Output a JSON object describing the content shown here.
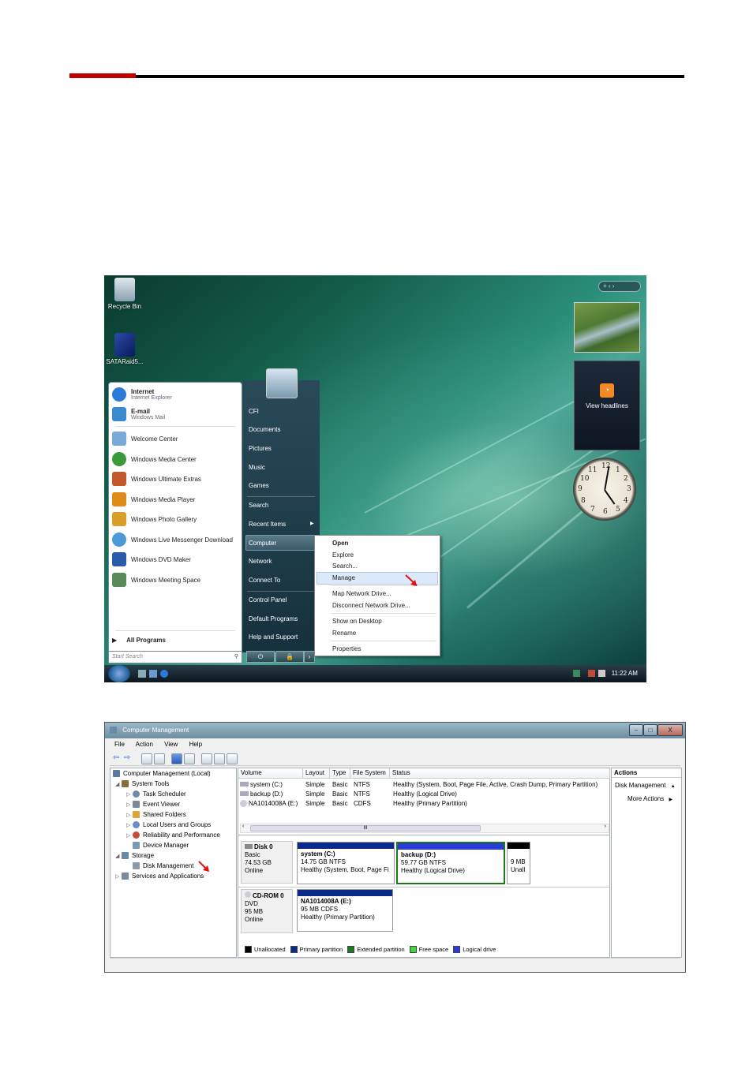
{
  "desktop": {
    "icons": [
      {
        "label": "Recycle Bin"
      },
      {
        "label": "SATARaid5..."
      }
    ],
    "gadgets": {
      "sidebar_controls": "+ ‹ ›",
      "news_label": "View headlines",
      "clock_numbers": [
        "12",
        "1",
        "2",
        "3",
        "4",
        "5",
        "6",
        "7",
        "8",
        "9",
        "10",
        "11"
      ]
    },
    "start_menu": {
      "pinned": [
        {
          "label": "Internet",
          "sub": "Internet Explorer",
          "color": "#2a7ad8"
        },
        {
          "label": "E-mail",
          "sub": "Windows Mail",
          "color": "#3a8ad0"
        }
      ],
      "recent": [
        {
          "label": "Welcome Center",
          "color": "#7aa8d8"
        },
        {
          "label": "Windows Media Center",
          "color": "#3a9a3a"
        },
        {
          "label": "Windows Ultimate Extras",
          "color": "#c05a2a"
        },
        {
          "label": "Windows Media Player",
          "color": "#e08a1a"
        },
        {
          "label": "Windows Photo Gallery",
          "color": "#d8a02a"
        },
        {
          "label": "Windows Live Messenger Download",
          "color": "#4a9ad8"
        },
        {
          "label": "Windows DVD Maker",
          "color": "#2a5aa8"
        },
        {
          "label": "Windows Meeting Space",
          "color": "#5a8a5a"
        }
      ],
      "all_programs": "All Programs",
      "search_placeholder": "Start Search",
      "right_items": [
        "CFI",
        "Documents",
        "Pictures",
        "Music",
        "Games",
        "Search",
        "Recent Items",
        "Computer",
        "Network",
        "Connect To",
        "Control Panel",
        "Default Programs",
        "Help and Support"
      ]
    },
    "context_menu": [
      "Open",
      "Explore",
      "Search...",
      "Manage",
      "Map Network Drive...",
      "Disconnect Network Drive...",
      "Show on Desktop",
      "Rename",
      "Properties"
    ],
    "taskbar": {
      "time": "11:22 AM"
    }
  },
  "mgmt": {
    "title": "Computer Management",
    "window_buttons": [
      "–",
      "□",
      "X"
    ],
    "menu": [
      "File",
      "Action",
      "View",
      "Help"
    ],
    "tree": [
      {
        "label": "Computer Management (Local)",
        "color": "#5a7a9a"
      },
      {
        "label": "System Tools",
        "color": "#8a6a3a"
      },
      {
        "label": "Task Scheduler",
        "color": "#6a8aa8"
      },
      {
        "label": "Event Viewer",
        "color": "#7a8a9a"
      },
      {
        "label": "Shared Folders",
        "color": "#d8a83a"
      },
      {
        "label": "Local Users and Groups",
        "color": "#6a8ac8"
      },
      {
        "label": "Reliability and Performance",
        "color": "#c84a3a"
      },
      {
        "label": "Device Manager",
        "color": "#7a9ab8"
      },
      {
        "label": "Storage",
        "color": "#6a8aa8"
      },
      {
        "label": "Disk Management",
        "color": "#8a9aa8"
      },
      {
        "label": "Services and Applications",
        "color": "#7a8a9a"
      }
    ],
    "columns": [
      "Volume",
      "Layout",
      "Type",
      "File System",
      "Status"
    ],
    "rows": [
      {
        "volume": "system (C:)",
        "layout": "Simple",
        "type": "Basic",
        "fs": "NTFS",
        "status": "Healthy (System, Boot, Page File, Active, Crash Dump, Primary Partition)"
      },
      {
        "volume": "backup (D:)",
        "layout": "Simple",
        "type": "Basic",
        "fs": "NTFS",
        "status": "Healthy (Logical Drive)"
      },
      {
        "volume": "NA1014008A (E:)",
        "layout": "Simple",
        "type": "Basic",
        "fs": "CDFS",
        "status": "Healthy (Primary Partition)"
      }
    ],
    "scroll_mid": "III",
    "disks": {
      "disk0": {
        "name": "Disk 0",
        "type": "Basic",
        "size": "74.53 GB",
        "state": "Online"
      },
      "cd0": {
        "name": "CD-ROM 0",
        "type": "DVD",
        "size": "95 MB",
        "state": "Online"
      }
    },
    "partitions": {
      "c": {
        "name": "system  (C:)",
        "size": "14.75 GB NTFS",
        "status": "Healthy (System, Boot, Page Fi"
      },
      "d": {
        "name": "backup  (D:)",
        "size": "59.77 GB NTFS",
        "status": "Healthy (Logical Drive)"
      },
      "u": {
        "size": "9 MB",
        "status": "Unall"
      },
      "e": {
        "name": "NA1014008A  (E:)",
        "size": "95 MB CDFS",
        "status": "Healthy (Primary Partition)"
      }
    },
    "legend": [
      {
        "label": "Unallocated",
        "color": "#000000"
      },
      {
        "label": "Primary partition",
        "color": "#0a2a8a"
      },
      {
        "label": "Extended partition",
        "color": "#1a7a1a"
      },
      {
        "label": "Free space",
        "color": "#3ad83a"
      },
      {
        "label": "Logical drive",
        "color": "#2a3ad8"
      }
    ],
    "actions": {
      "header": "Actions",
      "section": "Disk Management",
      "more": "More Actions"
    }
  }
}
